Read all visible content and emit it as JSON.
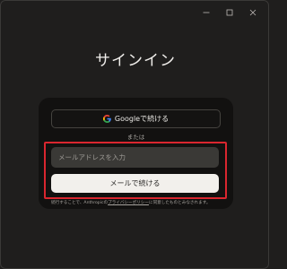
{
  "title": "サインイン",
  "google_button": {
    "label": "Googleで続ける"
  },
  "divider_text": "または",
  "email_input": {
    "placeholder": "メールアドレスを入力",
    "value": ""
  },
  "continue_button": {
    "label": "メールで続ける"
  },
  "privacy": {
    "prefix": "続行することで、Anthropicの",
    "link": "プライバシーポリシー",
    "suffix": "に同意したものとみなされます。"
  },
  "colors": {
    "highlight": "#d9262f",
    "background": "#1f1e1d",
    "card": "#121110"
  },
  "icons": [
    "minimize-icon",
    "maximize-icon",
    "close-icon",
    "google-icon"
  ]
}
